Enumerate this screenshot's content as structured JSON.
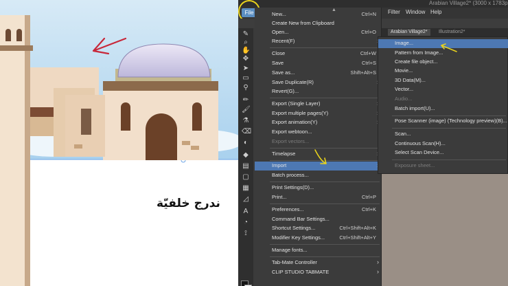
{
  "caption": "ندرج خلفيّة",
  "window_title": "Arabian Village2* (3000 x 1783px 96dp",
  "menubar": {
    "file": "File",
    "items": [
      "Filter",
      "Window",
      "Help"
    ]
  },
  "tabs": [
    "Arabian Village2*",
    "Illustration2*"
  ],
  "file_menu": {
    "scroll_up": "▲",
    "scroll_down": "▼",
    "items": [
      {
        "label": "New...",
        "shortcut": "Ctrl+N"
      },
      {
        "label": "Create New from Clipboard",
        "shortcut": ""
      },
      {
        "label": "Open...",
        "shortcut": "Ctrl+O"
      },
      {
        "label": "Recent(F)",
        "shortcut": "",
        "arrow": "›"
      },
      {
        "label": "Close",
        "shortcut": "Ctrl+W"
      },
      {
        "label": "Save",
        "shortcut": "Ctrl+S"
      },
      {
        "label": "Save as...",
        "shortcut": "Shift+Alt+S"
      },
      {
        "label": "Save Duplicate(R)",
        "shortcut": "",
        "arrow": "›"
      },
      {
        "label": "Revert(G)...",
        "shortcut": ""
      },
      {
        "label": "Export (Single Layer)",
        "shortcut": "",
        "arrow": "›"
      },
      {
        "label": "Export multiple pages(Y)",
        "shortcut": "",
        "arrow": "›"
      },
      {
        "label": "Export animation(Y)",
        "shortcut": "",
        "arrow": "›"
      },
      {
        "label": "Export webtoon...",
        "shortcut": ""
      },
      {
        "label": "Export vectors...",
        "shortcut": ""
      },
      {
        "label": "Timelapse",
        "shortcut": "",
        "arrow": "›"
      },
      {
        "label": "Import",
        "shortcut": "",
        "arrow": "›"
      },
      {
        "label": "Batch process...",
        "shortcut": ""
      },
      {
        "label": "Print Settings(D)...",
        "shortcut": ""
      },
      {
        "label": "Print...",
        "shortcut": "Ctrl+P"
      },
      {
        "label": "Preferences...",
        "shortcut": "Ctrl+K"
      },
      {
        "label": "Command Bar Settings...",
        "shortcut": ""
      },
      {
        "label": "Shortcut Settings...",
        "shortcut": "Ctrl+Shift+Alt+K"
      },
      {
        "label": "Modifier Key Settings...",
        "shortcut": "Ctrl+Shift+Alt+Y"
      },
      {
        "label": "Manage fonts...",
        "shortcut": ""
      },
      {
        "label": "Tab-Mate Controller",
        "shortcut": "",
        "arrow": "›"
      },
      {
        "label": "CLIP STUDIO TABMATE",
        "shortcut": "",
        "arrow": "›"
      }
    ]
  },
  "import_menu": {
    "items": [
      {
        "label": "Image..."
      },
      {
        "label": "Pattern from Image..."
      },
      {
        "label": "Create file object..."
      },
      {
        "label": "Movie..."
      },
      {
        "label": "3D Data(M)..."
      },
      {
        "label": "Vector..."
      },
      {
        "label": "Audio..."
      },
      {
        "label": "Batch import(U)..."
      },
      {
        "label": "Pose Scanner (image) (Technology preview)(B)..."
      },
      {
        "label": "Scan..."
      },
      {
        "label": "Continuous Scan(H)..."
      },
      {
        "label": "Select Scan Device..."
      },
      {
        "label": "Exposure sheet..."
      }
    ]
  },
  "colors": {
    "accent": "#4d78b3",
    "annotation_yellow": "#e8d21c",
    "annotation_red": "#c8283a"
  }
}
